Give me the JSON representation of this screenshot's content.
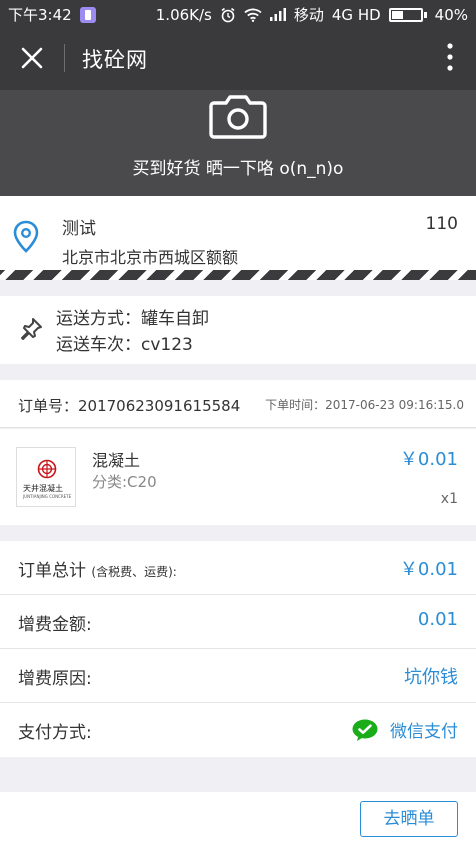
{
  "status_bar": {
    "time": "下午3:42",
    "speed": "1.06K/s",
    "carrier": "移动",
    "network": "4G HD",
    "battery": "40%",
    "battery_level": 0.4
  },
  "title_bar": {
    "title": "找砼网"
  },
  "banner": {
    "text": "买到好货 晒一下咯 o(n_n)o",
    "icon": "camera-icon"
  },
  "address": {
    "name": "测试",
    "phone": "110",
    "detail": "北京市北京市西城区额额"
  },
  "shipping": {
    "method": "运送方式：罐车自卸",
    "trip": "运送车次：cv123"
  },
  "order": {
    "number": "订单号：20170623091615584",
    "time": "下单时间：2017-06-23 09:16:15.0"
  },
  "product": {
    "name": "混凝土",
    "category": "分类:C20",
    "price": "￥0.01",
    "quantity": "x1",
    "brand": "天井混凝土",
    "brand_en": "JUNTIANJING CONCRETE"
  },
  "summary": {
    "total_label": "订单总计",
    "total_note": "(含税费、运费):",
    "total_value": "￥0.01",
    "extra_fee_label": "增费金额:",
    "extra_fee_value": "0.01",
    "extra_reason_label": "增费原因:",
    "extra_reason_value": "坑你钱",
    "payment_label": "支付方式:",
    "payment_value": "微信支付"
  },
  "footer": {
    "share_button": "去晒单"
  },
  "colors": {
    "accent": "#2b8dd6",
    "dark_bar": "#3a3a3c",
    "wechat_green": "#1aad19"
  }
}
